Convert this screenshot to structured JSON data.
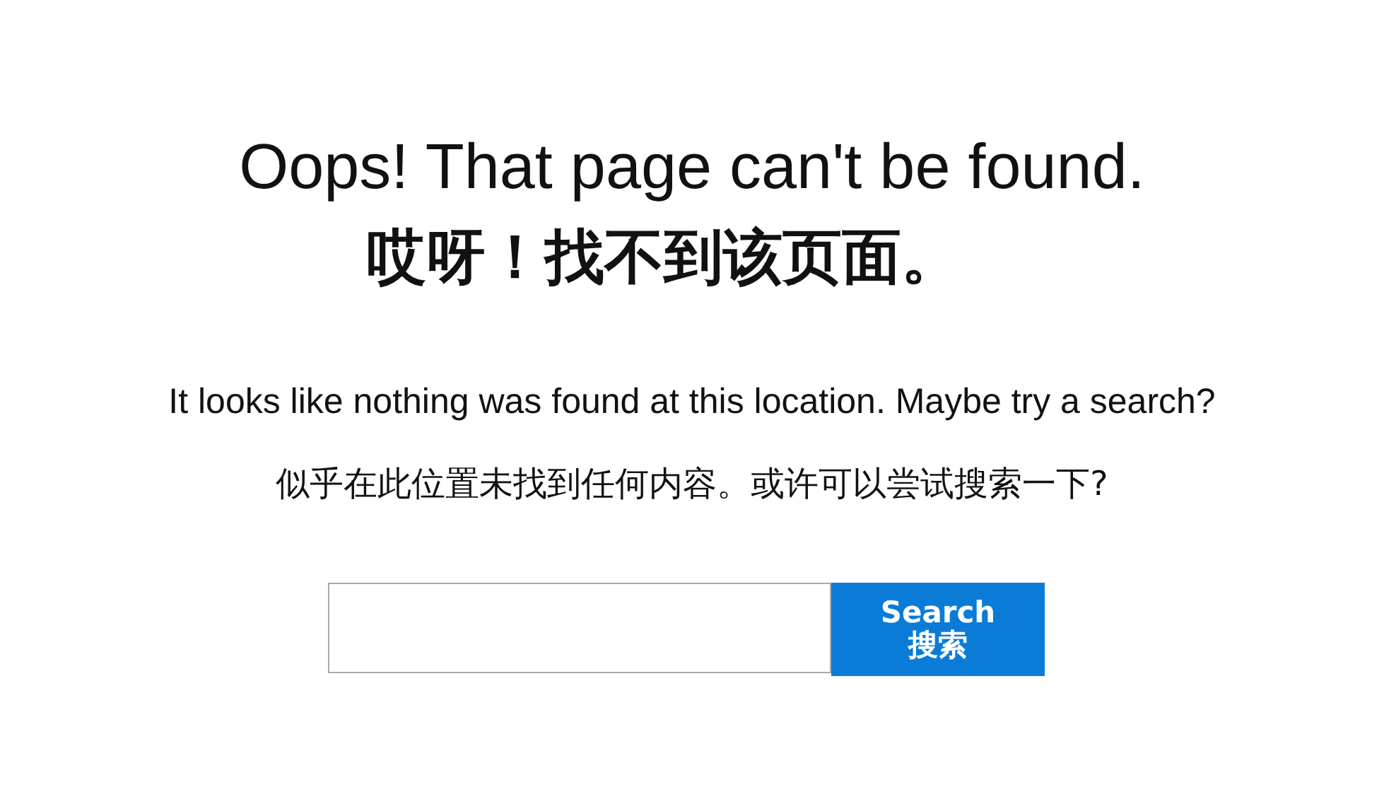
{
  "heading": "Oops! That page can't be found.",
  "heading_zh": "哎呀！找不到该页面。",
  "message": "It looks like nothing was found at this location. Maybe try a search?",
  "message_zh": "似乎在此位置未找到任何内容。或许可以尝试搜索一下?",
  "search": {
    "button_label": "Search",
    "button_label_zh": "搜索"
  }
}
